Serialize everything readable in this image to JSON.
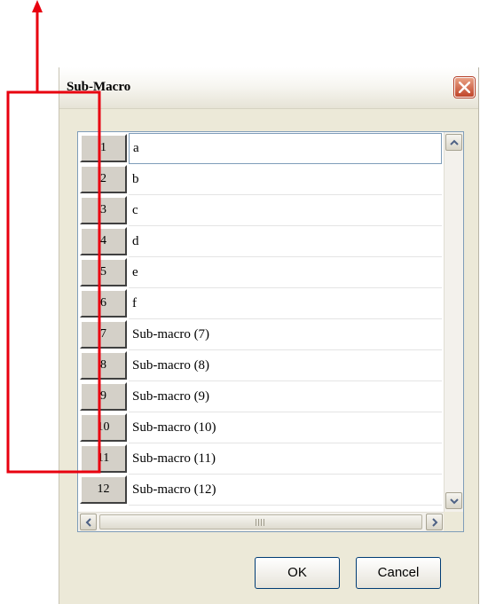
{
  "dialog": {
    "title": "Sub-Macro",
    "close_icon": "close-icon",
    "ok_label": "OK",
    "cancel_label": "Cancel"
  },
  "grid": {
    "rows": [
      {
        "index": "1",
        "value": "a"
      },
      {
        "index": "2",
        "value": "b"
      },
      {
        "index": "3",
        "value": "c"
      },
      {
        "index": "4",
        "value": "d"
      },
      {
        "index": "5",
        "value": "e"
      },
      {
        "index": "6",
        "value": "f"
      },
      {
        "index": "7",
        "value": "Sub-macro (7)"
      },
      {
        "index": "8",
        "value": "Sub-macro (8)"
      },
      {
        "index": "9",
        "value": "Sub-macro (9)"
      },
      {
        "index": "10",
        "value": "Sub-macro (10)"
      },
      {
        "index": "11",
        "value": "Sub-macro (11)"
      },
      {
        "index": "12",
        "value": "Sub-macro (12)"
      }
    ],
    "selected_row": 0
  },
  "colors": {
    "annotation": "#e8000f",
    "button_border": "#003c74",
    "close_button": "#c0452a"
  }
}
